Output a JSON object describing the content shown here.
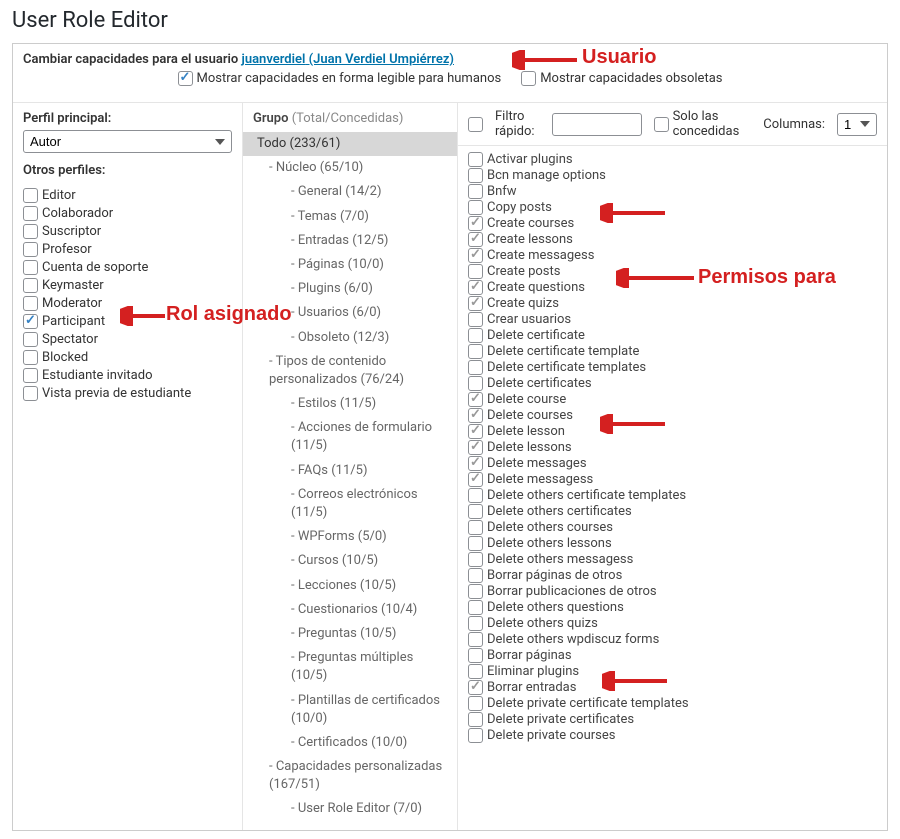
{
  "page_title": "User Role Editor",
  "header": {
    "prefix": "Cambiar capacidades para el usuario ",
    "user_login": "juanverdiel",
    "user_name": " (Juan Verdiel Umpiérrez)"
  },
  "options": {
    "human_readable": {
      "label": "Mostrar capacidades en forma legible para humanos",
      "checked": true
    },
    "obsolete": {
      "label": "Mostrar capacidades obsoletas",
      "checked": false
    }
  },
  "left": {
    "primary_label": "Perfil principal:",
    "primary_value": "Autor",
    "other_label": "Otros perfiles:",
    "roles": [
      {
        "label": "Editor",
        "checked": false
      },
      {
        "label": "Colaborador",
        "checked": false
      },
      {
        "label": "Suscriptor",
        "checked": false
      },
      {
        "label": "Profesor",
        "checked": false
      },
      {
        "label": "Cuenta de soporte",
        "checked": false
      },
      {
        "label": "Keymaster",
        "checked": false
      },
      {
        "label": "Moderator",
        "checked": false
      },
      {
        "label": "Participant",
        "checked": true
      },
      {
        "label": "Spectator",
        "checked": false
      },
      {
        "label": "Blocked",
        "checked": false
      },
      {
        "label": "Estudiante invitado",
        "checked": false
      },
      {
        "label": "Vista previa de estudiante",
        "checked": false
      }
    ]
  },
  "mid": {
    "header": "Grupo",
    "header_suffix": " (Total/Concedidas)",
    "tree": [
      {
        "label": "Todo (233/61)",
        "level": 1,
        "selected": true
      },
      {
        "label": "- Núcleo (65/10)",
        "level": 2
      },
      {
        "label": "- General (14/2)",
        "level": 3
      },
      {
        "label": "- Temas (7/0)",
        "level": 3
      },
      {
        "label": "- Entradas (12/5)",
        "level": 3
      },
      {
        "label": "- Páginas (10/0)",
        "level": 3
      },
      {
        "label": "- Plugins (6/0)",
        "level": 3
      },
      {
        "label": "- Usuarios (6/0)",
        "level": 3
      },
      {
        "label": "- Obsoleto (12/3)",
        "level": 3
      },
      {
        "label": "- Tipos de contenido personalizados (76/24)",
        "level": 2
      },
      {
        "label": "- Estilos (11/5)",
        "level": 3
      },
      {
        "label": "- Acciones de formulario (11/5)",
        "level": 3
      },
      {
        "label": "- FAQs (11/5)",
        "level": 3
      },
      {
        "label": "- Correos electrónicos (11/5)",
        "level": 3
      },
      {
        "label": "- WPForms (5/0)",
        "level": 3
      },
      {
        "label": "- Cursos (10/5)",
        "level": 3
      },
      {
        "label": "- Lecciones (10/5)",
        "level": 3
      },
      {
        "label": "- Cuestionarios (10/4)",
        "level": 3
      },
      {
        "label": "- Preguntas (10/5)",
        "level": 3
      },
      {
        "label": "- Preguntas múltiples (10/5)",
        "level": 3
      },
      {
        "label": "- Plantillas de certificados (10/0)",
        "level": 3
      },
      {
        "label": "- Certificados (10/0)",
        "level": 3
      },
      {
        "label": "- Capacidades personalizadas (167/51)",
        "level": 2
      },
      {
        "label": "- User Role Editor (7/0)",
        "level": 3
      }
    ]
  },
  "right": {
    "filter_label": "Filtro rápido:",
    "filter_value": "",
    "granted_only": {
      "label": "Solo las concedidas",
      "checked": false
    },
    "columns_label": "Columnas:",
    "columns_value": "1",
    "caps": [
      {
        "label": "Activar plugins",
        "checked": false
      },
      {
        "label": "Bcn manage options",
        "checked": false
      },
      {
        "label": "Bnfw",
        "checked": false
      },
      {
        "label": "Copy posts",
        "checked": false
      },
      {
        "label": "Create courses",
        "checked": true,
        "gray": true
      },
      {
        "label": "Create lessons",
        "checked": true,
        "gray": true
      },
      {
        "label": "Create messagess",
        "checked": true,
        "gray": true
      },
      {
        "label": "Create posts",
        "checked": false
      },
      {
        "label": "Create questions",
        "checked": true,
        "gray": true
      },
      {
        "label": "Create quizs",
        "checked": true,
        "gray": true
      },
      {
        "label": "Crear usuarios",
        "checked": false
      },
      {
        "label": "Delete certificate",
        "checked": false
      },
      {
        "label": "Delete certificate template",
        "checked": false
      },
      {
        "label": "Delete certificate templates",
        "checked": false
      },
      {
        "label": "Delete certificates",
        "checked": false
      },
      {
        "label": "Delete course",
        "checked": true,
        "gray": true
      },
      {
        "label": "Delete courses",
        "checked": true,
        "gray": true
      },
      {
        "label": "Delete lesson",
        "checked": true,
        "gray": true
      },
      {
        "label": "Delete lessons",
        "checked": true,
        "gray": true
      },
      {
        "label": "Delete messages",
        "checked": true,
        "gray": true
      },
      {
        "label": "Delete messagess",
        "checked": true,
        "gray": true
      },
      {
        "label": "Delete others certificate templates",
        "checked": false
      },
      {
        "label": "Delete others certificates",
        "checked": false
      },
      {
        "label": "Delete others courses",
        "checked": false
      },
      {
        "label": "Delete others lessons",
        "checked": false
      },
      {
        "label": "Delete others messagess",
        "checked": false
      },
      {
        "label": "Borrar páginas de otros",
        "checked": false
      },
      {
        "label": "Borrar publicaciones de otros",
        "checked": false
      },
      {
        "label": "Delete others questions",
        "checked": false
      },
      {
        "label": "Delete others quizs",
        "checked": false
      },
      {
        "label": "Delete others wpdiscuz forms",
        "checked": false
      },
      {
        "label": "Borrar páginas",
        "checked": false
      },
      {
        "label": "Eliminar plugins",
        "checked": false
      },
      {
        "label": "Borrar entradas",
        "checked": true,
        "gray": true
      },
      {
        "label": "Delete private certificate templates",
        "checked": false
      },
      {
        "label": "Delete private certificates",
        "checked": false
      },
      {
        "label": "Delete private courses",
        "checked": false
      }
    ]
  },
  "annotations": {
    "usuario": "Usuario",
    "rol": "Rol asignado",
    "permisos": "Permisos para"
  }
}
